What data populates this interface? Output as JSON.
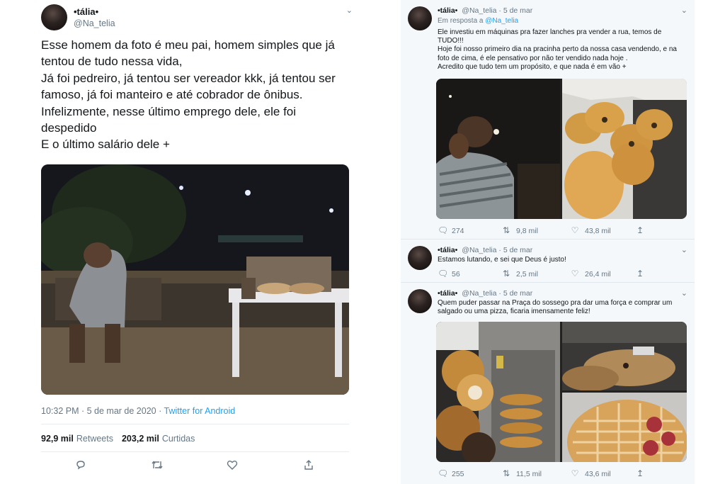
{
  "main_tweet": {
    "author_name": "•tália•",
    "author_handle": "@Na_telia",
    "text_lines": [
      "Esse homem da foto é meu pai, homem simples que já",
      "tentou de tudo nessa vida,",
      "Já foi pedreiro, já tentou ser vereador kkk, já tentou ser",
      "famoso, já foi manteiro e até cobrador de ônibus.",
      "Infelizmente, nesse último emprego dele, ele foi",
      "despedido",
      "E o último salário dele +"
    ],
    "timestamp": "10:32 PM · 5 de mar de 2020 · ",
    "source": "Twitter for Android",
    "retweets_count": "92,9 mil",
    "retweets_label": "Retweets",
    "likes_count": "203,2 mil",
    "likes_label": "Curtidas",
    "icons": {
      "reply": "reply-icon",
      "retweet": "retweet-icon",
      "like": "like-icon",
      "share": "share-icon"
    }
  },
  "replies": [
    {
      "author_name": "•tália•",
      "author_handle": "@Na_telia",
      "date": "· 5 de mar",
      "reply_to_prefix": "Em resposta a ",
      "reply_to_handle": "@Na_telia",
      "text_lines": [
        "Ele investiu em máquinas pra fazer lanches pra vender a rua, temos de",
        "TUDO!!!",
        "Hoje foi nosso primeiro dia na pracinha perto da nossa casa vendendo, e na",
        "foto de cima, é ele pensativo por não ter vendido nada hoje .",
        "Acredito que tudo tem um propósito, e que nada é em vão +"
      ],
      "reply_count": "274",
      "retweet_count": "9,8 mil",
      "like_count": "43,8 mil"
    },
    {
      "author_name": "•tália•",
      "author_handle": "@Na_telia",
      "date": "· 5 de mar",
      "text_lines": [
        "Estamos lutando, e sei que Deus é justo!"
      ],
      "reply_count": "56",
      "retweet_count": "2,5 mil",
      "like_count": "26,4 mil"
    },
    {
      "author_name": "•tália•",
      "author_handle": "@Na_telia",
      "date": "· 5 de mar",
      "text_lines": [
        "Quem puder passar na Praça do sossego pra dar uma força e comprar um",
        "salgado ou uma pizza, ficaria imensamente feliz!"
      ],
      "reply_count": "255",
      "retweet_count": "11,5 mil",
      "like_count": "43,6 mil"
    }
  ],
  "colors": {
    "accent": "#1da1f2",
    "muted": "#657786",
    "text": "#14171a",
    "panel": "#f5f8fa"
  }
}
